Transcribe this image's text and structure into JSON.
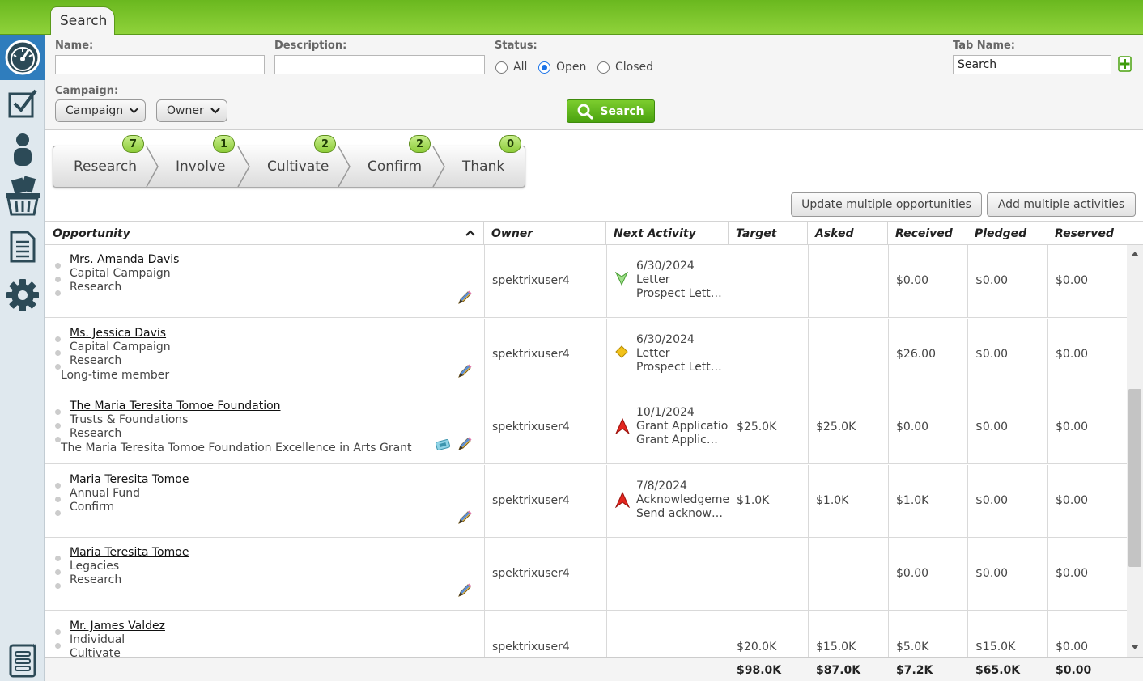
{
  "tab": {
    "label": "Search"
  },
  "search": {
    "name_label": "Name:",
    "name_value": "",
    "description_label": "Description:",
    "description_value": "",
    "status_label": "Status:",
    "status_options": [
      "All",
      "Open",
      "Closed"
    ],
    "status_selected": "Open",
    "tab_name_label": "Tab Name:",
    "tab_name_value": "Search",
    "campaign_label": "Campaign:",
    "campaign_dropdown": "Campaign",
    "owner_dropdown": "Owner",
    "search_button": "Search"
  },
  "pipeline": [
    {
      "label": "Research",
      "count": "7"
    },
    {
      "label": "Involve",
      "count": "1"
    },
    {
      "label": "Cultivate",
      "count": "2"
    },
    {
      "label": "Confirm",
      "count": "2"
    },
    {
      "label": "Thank",
      "count": "0"
    }
  ],
  "actions": {
    "update_multiple": "Update multiple opportunities",
    "add_activities": "Add multiple activities"
  },
  "columns": [
    "Opportunity",
    "Owner",
    "Next Activity",
    "Target",
    "Asked",
    "Received",
    "Pledged",
    "Reserved"
  ],
  "rows": [
    {
      "name": "Mrs. Amanda Davis",
      "fund": "Capital Campaign",
      "stage": "Research",
      "note": "",
      "owner": "spektrixuser4",
      "activity_date": "6/30/2024",
      "activity_type": "Letter",
      "activity_desc": "Prospect Lett…",
      "activity_icon": "green-arrow-down-icon",
      "target": "",
      "asked": "",
      "received": "$0.00",
      "pledged": "$0.00",
      "reserved": "$0.00",
      "ticket": false
    },
    {
      "name": "Ms. Jessica Davis",
      "fund": "Capital Campaign",
      "stage": "Research",
      "note": "Long-time member",
      "owner": "spektrixuser4",
      "activity_date": "6/30/2024",
      "activity_type": "Letter",
      "activity_desc": "Prospect Lett…",
      "activity_icon": "yellow-diamond-icon",
      "target": "",
      "asked": "",
      "received": "$26.00",
      "pledged": "$0.00",
      "reserved": "$0.00",
      "ticket": false
    },
    {
      "name": "The Maria Teresita Tomoe Foundation",
      "fund": "Trusts & Foundations",
      "stage": "Research",
      "note": "The Maria Teresita Tomoe Foundation Excellence in Arts Grant",
      "owner": "spektrixuser4",
      "activity_date": "10/1/2024",
      "activity_type": "Grant Application",
      "activity_desc": "Grant Applic…",
      "activity_icon": "red-arrow-up-icon",
      "target": "$25.0K",
      "asked": "$25.0K",
      "received": "$0.00",
      "pledged": "$0.00",
      "reserved": "$0.00",
      "ticket": true
    },
    {
      "name": "Maria Teresita Tomoe",
      "fund": "Annual Fund",
      "stage": "Confirm",
      "note": "",
      "owner": "spektrixuser4",
      "activity_date": "7/8/2024",
      "activity_type": "Acknowledgement",
      "activity_desc": "Send acknow…",
      "activity_icon": "red-arrow-up-icon",
      "target": "$1.0K",
      "asked": "$1.0K",
      "received": "$1.0K",
      "pledged": "$0.00",
      "reserved": "$0.00",
      "ticket": false
    },
    {
      "name": "Maria Teresita Tomoe",
      "fund": "Legacies",
      "stage": "Research",
      "note": "",
      "owner": "spektrixuser4",
      "activity_date": "",
      "activity_type": "",
      "activity_desc": "",
      "activity_icon": "",
      "target": "",
      "asked": "",
      "received": "$0.00",
      "pledged": "$0.00",
      "reserved": "$0.00",
      "ticket": false
    },
    {
      "name": "Mr. James Valdez",
      "fund": "Individual",
      "stage": "Cultivate",
      "note": "",
      "owner": "spektrixuser4",
      "activity_date": "",
      "activity_type": "",
      "activity_desc": "",
      "activity_icon": "",
      "target": "$20.0K",
      "asked": "$15.0K",
      "received": "$5.0K",
      "pledged": "$15.0K",
      "reserved": "$0.00",
      "ticket": false
    }
  ],
  "totals": {
    "target": "$98.0K",
    "asked": "$87.0K",
    "received": "$7.2K",
    "pledged": "$65.0K",
    "reserved": "$0.00"
  },
  "colors": {
    "brand_green": "#7cc52a",
    "sidebar_active": "#2f7dbd",
    "icon_dark": "#2c4a57"
  }
}
